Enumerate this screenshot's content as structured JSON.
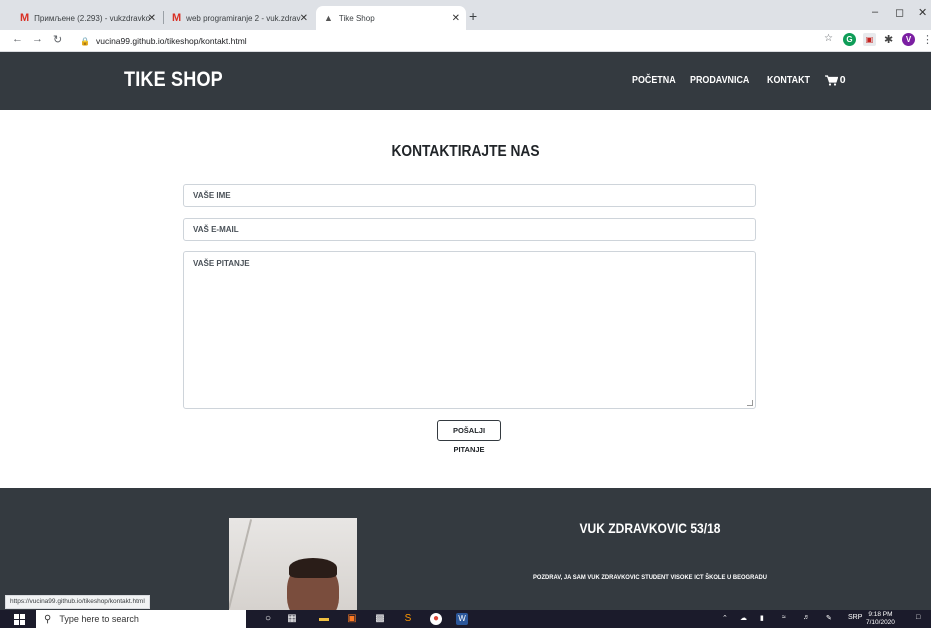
{
  "browser": {
    "tabs": [
      {
        "title": "Примљене (2.293) - vukzdravko",
        "icon": "gmail-icon"
      },
      {
        "title": "web programiranje 2 - vuk.zdrav",
        "icon": "gmail-icon"
      },
      {
        "title": "Tike Shop",
        "icon": "site-icon"
      }
    ],
    "url": "vucina99.github.io/tikeshop/kontakt.html",
    "status_url": "https://vucina99.github.io/tikeshop/kontakt.html"
  },
  "site": {
    "brand": "TIKE SHOP",
    "nav": [
      "POČETNA",
      "PRODAVNICA",
      "KONTAKT"
    ],
    "cart_count": "0"
  },
  "contact": {
    "title": "KONTAKTIRAJTE NAS",
    "name_placeholder": "VAŠE IME",
    "email_placeholder": "VAŠ E-MAIL",
    "question_placeholder": "VAŠE PITANJE",
    "submit_label": "POŠALJI PITANJE"
  },
  "footer": {
    "author": "VUK ZDRAVKOVIC 53/18",
    "bio": "POZDRAV, JA SAM VUK ZDRAVKOVIC STUDENT VISOKE ICT ŠKOLE U BEOGRADU"
  },
  "taskbar": {
    "search_placeholder": "Type here to search",
    "language": "SRP",
    "time": "9:18 PM",
    "date": "7/10/2020"
  }
}
